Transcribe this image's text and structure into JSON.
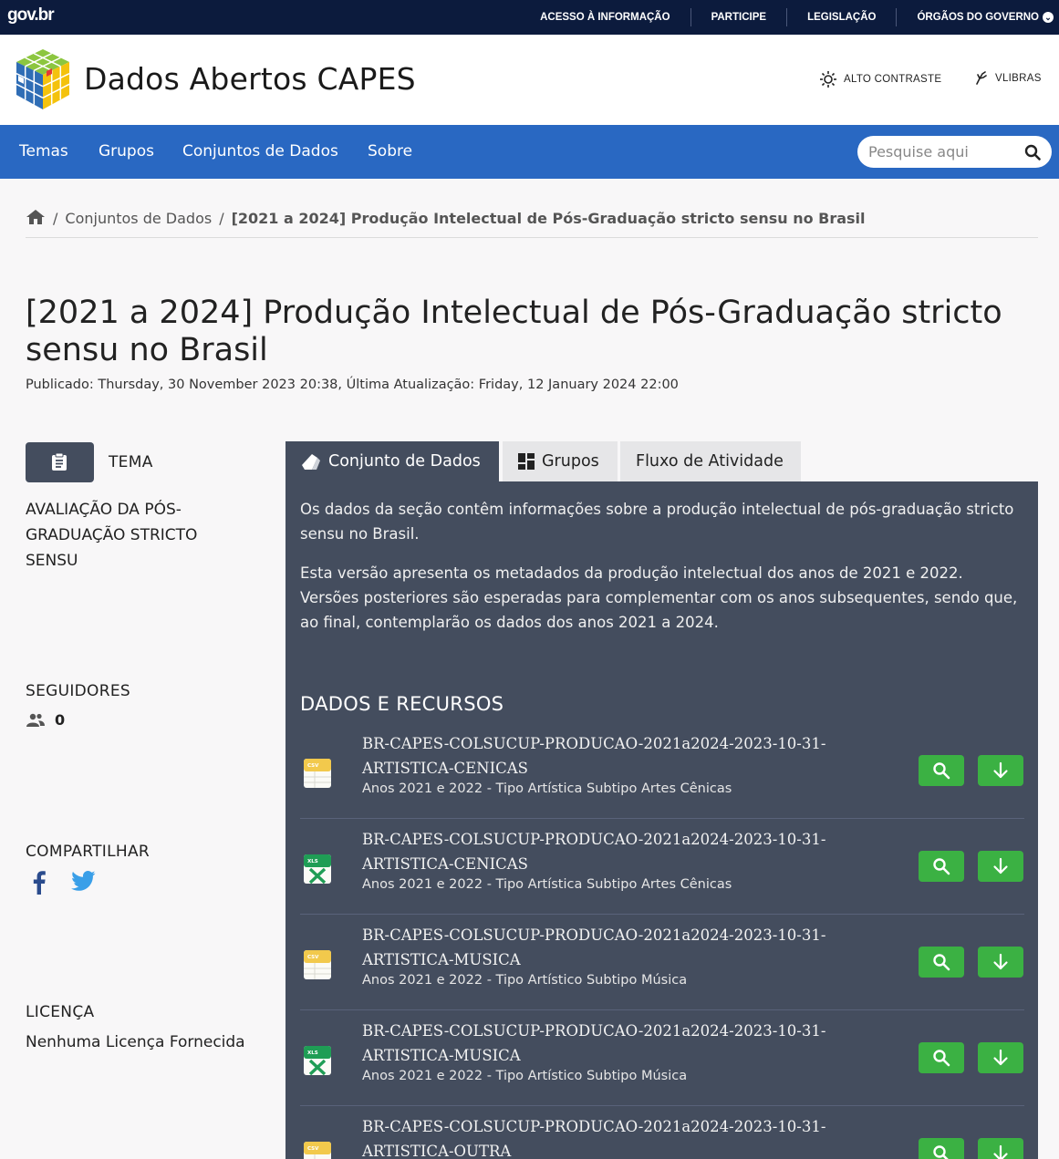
{
  "govbar": {
    "logo": "gov.br",
    "links": [
      "ACESSO À INFORMAÇÃO",
      "PARTICIPE",
      "LEGISLAÇÃO",
      "ÓRGÃOS DO GOVERNO"
    ]
  },
  "header": {
    "title": "Dados Abertos CAPES",
    "high_contrast": "ALTO CONTRASTE",
    "vlibras": "VLIBRAS"
  },
  "nav": {
    "items": [
      "Temas",
      "Grupos",
      "Conjuntos de Dados",
      "Sobre"
    ],
    "search_placeholder": "Pesquise aqui"
  },
  "breadcrumb": {
    "items": [
      "Conjuntos de Dados",
      "[2021 a 2024] Produção Intelectual de Pós-Graduação stricto sensu no Brasil"
    ]
  },
  "page": {
    "title": "[2021 a 2024] Produção Intelectual de Pós-Graduação stricto sensu no Brasil",
    "published": "Publicado: Thursday, 30 November 2023 20:38, Última Atualização: Friday, 12 January 2024 22:00"
  },
  "sidebar": {
    "tema_label": "TEMA",
    "tema_value": "AVALIAÇÃO DA PÓS-GRADUAÇÃO STRICTO SENSU",
    "followers_label": "SEGUIDORES",
    "followers_count": "0",
    "share_label": "COMPARTILHAR",
    "license_label": "LICENÇA",
    "license_value": "Nenhuma Licença Fornecida"
  },
  "tabs": [
    "Conjunto de Dados",
    "Grupos",
    "Fluxo de Atividade"
  ],
  "content": {
    "desc1": "Os dados da seção contêm informações sobre a produção intelectual de pós-graduação stricto sensu no Brasil.",
    "desc2": "Esta versão apresenta os metadados da produção intelectual dos anos de 2021 e 2022. Versões posteriores são esperadas para complementar com os anos subsequentes, sendo que, ao final, contemplarão os dados dos anos 2021 a 2024.",
    "resources_heading": "DADOS E RECURSOS",
    "resources": [
      {
        "format": "csv",
        "name": "BR-CAPES-COLSUCUP-PRODUCAO-2021a2024-2023-10-31-ARTISTICA-CENICAS",
        "desc": "Anos 2021 e 2022 - Tipo Artística Subtipo Artes Cênicas"
      },
      {
        "format": "xls",
        "name": "BR-CAPES-COLSUCUP-PRODUCAO-2021a2024-2023-10-31-ARTISTICA-CENICAS",
        "desc": "Anos 2021 e 2022 - Tipo Artística Subtipo Artes Cênicas"
      },
      {
        "format": "csv",
        "name": "BR-CAPES-COLSUCUP-PRODUCAO-2021a2024-2023-10-31-ARTISTICA-MUSICA",
        "desc": "Anos 2021 e 2022 - Tipo Artístico Subtipo Música"
      },
      {
        "format": "xls",
        "name": "BR-CAPES-COLSUCUP-PRODUCAO-2021a2024-2023-10-31-ARTISTICA-MUSICA",
        "desc": "Anos 2021 e 2022 - Tipo Artístico Subtipo Música"
      },
      {
        "format": "csv",
        "name": "BR-CAPES-COLSUCUP-PRODUCAO-2021a2024-2023-10-31-ARTISTICA-OUTRA",
        "desc": ""
      }
    ]
  }
}
